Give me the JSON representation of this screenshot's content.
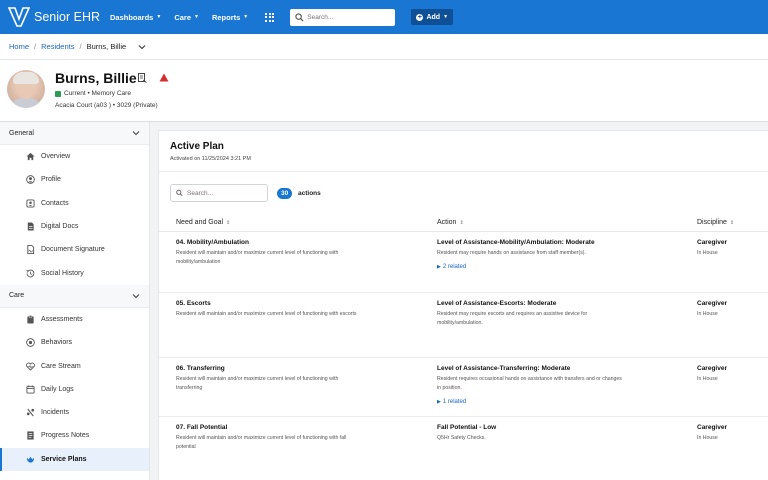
{
  "app": {
    "name": "Senior EHR",
    "nav": [
      {
        "label": "Dashboards"
      },
      {
        "label": "Care"
      },
      {
        "label": "Reports"
      }
    ],
    "search_placeholder": "Search...",
    "add_label": "Add",
    "brand_color": "#1976d2"
  },
  "breadcrumb": {
    "items": [
      "Home",
      "Residents"
    ],
    "current": "Burns, Billie"
  },
  "resident": {
    "name": "Burns, Billie",
    "status": "Current • Memory Care",
    "location": "Acacia Court (a03 ) • 3029 (Private)",
    "status_color": "#2e9c57",
    "alert_color": "#d32f2f"
  },
  "sidebar": {
    "general": {
      "title": "General",
      "items": [
        {
          "label": "Overview",
          "icon": "home-icon"
        },
        {
          "label": "Profile",
          "icon": "user-icon"
        },
        {
          "label": "Contacts",
          "icon": "contacts-icon"
        },
        {
          "label": "Digital Docs",
          "icon": "document-icon"
        },
        {
          "label": "Document Signature",
          "icon": "signature-icon"
        },
        {
          "label": "Social History",
          "icon": "history-icon"
        }
      ]
    },
    "care": {
      "title": "Care",
      "items": [
        {
          "label": "Assessments",
          "icon": "clipboard-icon"
        },
        {
          "label": "Behaviors",
          "icon": "behavior-icon"
        },
        {
          "label": "Care Stream",
          "icon": "heart-icon"
        },
        {
          "label": "Daily Logs",
          "icon": "log-icon"
        },
        {
          "label": "Incidents",
          "icon": "incident-icon"
        },
        {
          "label": "Progress Notes",
          "icon": "notes-icon"
        },
        {
          "label": "Service Plans",
          "icon": "service-plan-icon",
          "active": true
        }
      ]
    }
  },
  "plan": {
    "title": "Active Plan",
    "activated": "Activated on 11/25/2024 3:21 PM",
    "search_placeholder": "Search...",
    "count": "30",
    "count_label": "actions",
    "columns": [
      "Need and Goal",
      "Action",
      "Discipline"
    ],
    "rows": [
      {
        "need_title": "04. Mobility/Ambulation",
        "need_desc": "Resident will maintain and/or maximize current level of functioning with mobility/ambulation",
        "action_title": "Level of Assistance-Mobility/Ambulation: Moderate",
        "action_desc": "Resident may require hands on assistance from staff member(s).",
        "related": "2 related",
        "discipline": "Caregiver",
        "discipline_sub": "In House"
      },
      {
        "need_title": "05. Escorts",
        "need_desc": "Resident will maintain and/or maximize current level of functioning with escorts",
        "action_title": "Level of Assistance-Escorts: Moderate",
        "action_desc": "Resident may require escorts and requires an assistive device for mobility/ambulation.",
        "related": "",
        "discipline": "Caregiver",
        "discipline_sub": "In House"
      },
      {
        "need_title": "06. Transferring",
        "need_desc": "Resident will maintain and/or maximize current level of functioning with transferring",
        "action_title": "Level of Assistance-Transferring: Moderate",
        "action_desc": "Resident requires occasional hands on assistance with transfers and or changes in position.",
        "related": "1 related",
        "discipline": "Caregiver",
        "discipline_sub": "In House"
      },
      {
        "need_title": "07. Fall Potential",
        "need_desc": "Resident will maintain and/or maximize current level of functioning with fall potential",
        "action_title": "Fall Potential - Low",
        "action_desc": "Q5Hr Safety Checks.",
        "related": "",
        "discipline": "Caregiver",
        "discipline_sub": "In House"
      }
    ]
  }
}
